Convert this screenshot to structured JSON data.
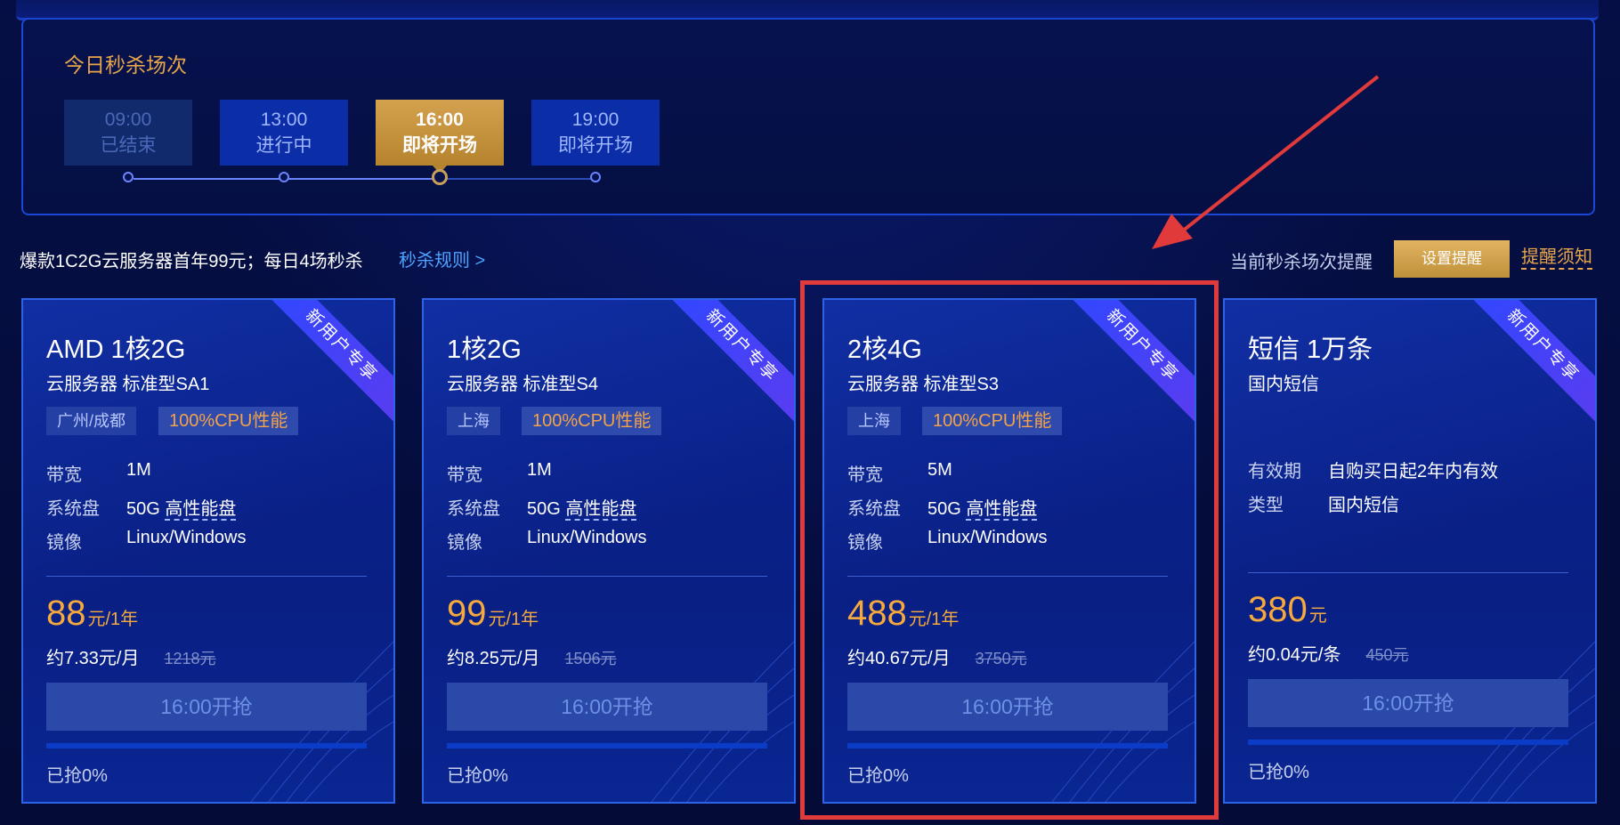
{
  "session": {
    "title": "今日秒杀场次",
    "slots": [
      {
        "time": "09:00",
        "status": "已结束",
        "state": "ended"
      },
      {
        "time": "13:00",
        "status": "进行中",
        "state": "running"
      },
      {
        "time": "16:00",
        "status": "即将开场",
        "state": "active"
      },
      {
        "time": "19:00",
        "status": "即将开场",
        "state": "upcoming"
      }
    ]
  },
  "info_bar": {
    "promo": "爆款1C2G云服务器首年99元；每日4场秒杀",
    "rules_link": "秒杀规则 >",
    "reminder_text": "当前秒杀场次提醒",
    "reminder_button": "设置提醒",
    "notice_link": "提醒须知"
  },
  "ribbon_label": "新用户专享",
  "cards": [
    {
      "title": "AMD 1核2G",
      "subtitle": "云服务器 标准型SA1",
      "region": "广州/成都",
      "cpu_tag": "100%CPU性能",
      "specs": [
        {
          "label": "带宽",
          "value": "1M"
        },
        {
          "label": "系统盘",
          "value_prefix": "50G ",
          "value": "高性能盘"
        },
        {
          "label": "镜像",
          "value": "Linux/Windows"
        }
      ],
      "price": "88",
      "price_unit": "元/1年",
      "per_month": "约7.33元/月",
      "original_price": "1218元",
      "button": "16:00开抢",
      "progress_text": "已抢0%",
      "progress": 0
    },
    {
      "title": "1核2G",
      "subtitle": "云服务器 标准型S4",
      "region": "上海",
      "cpu_tag": "100%CPU性能",
      "specs": [
        {
          "label": "带宽",
          "value": "1M"
        },
        {
          "label": "系统盘",
          "value_prefix": "50G ",
          "value": "高性能盘"
        },
        {
          "label": "镜像",
          "value": "Linux/Windows"
        }
      ],
      "price": "99",
      "price_unit": "元/1年",
      "per_month": "约8.25元/月",
      "original_price": "1506元",
      "button": "16:00开抢",
      "progress_text": "已抢0%",
      "progress": 0
    },
    {
      "title": "2核4G",
      "subtitle": "云服务器 标准型S3",
      "region": "上海",
      "cpu_tag": "100%CPU性能",
      "specs": [
        {
          "label": "带宽",
          "value": "5M"
        },
        {
          "label": "系统盘",
          "value_prefix": "50G ",
          "value": "高性能盘"
        },
        {
          "label": "镜像",
          "value": "Linux/Windows"
        }
      ],
      "price": "488",
      "price_unit": "元/1年",
      "per_month": "约40.67元/月",
      "original_price": "3750元",
      "button": "16:00开抢",
      "progress_text": "已抢0%",
      "progress": 0
    },
    {
      "title": "短信 1万条",
      "subtitle": "国内短信",
      "specs": [
        {
          "label": "有效期",
          "value": "自购买日起2年内有效"
        },
        {
          "label": "类型",
          "value": "国内短信"
        }
      ],
      "price": "380",
      "price_unit": "元",
      "per_month": "约0.04元/条",
      "original_price": "450元",
      "button": "16:00开抢",
      "progress_text": "已抢0%",
      "progress": 0
    }
  ],
  "colors": {
    "accent_gold": "#e6a54a",
    "price_orange": "#f6a93c",
    "link_blue": "#4fa2ff",
    "highlight_red": "#e03a3a"
  }
}
